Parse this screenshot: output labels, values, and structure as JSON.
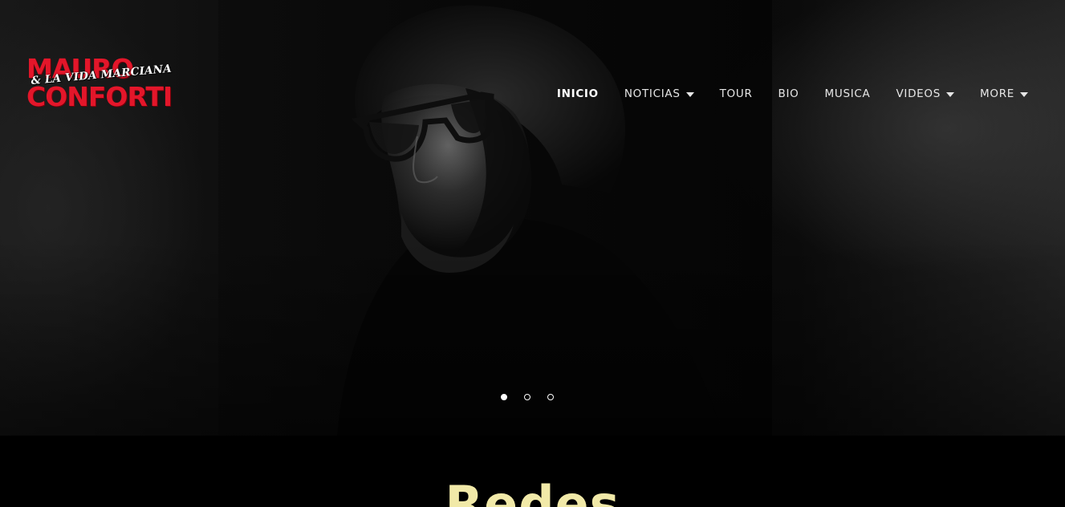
{
  "logo": {
    "line1": "MAURO",
    "subtitle": "& LA VIDA MARCIANA",
    "line2": "CONFORTI",
    "color": "#e3162a"
  },
  "nav": {
    "items": [
      {
        "label": "INICIO",
        "active": true,
        "dropdown": false
      },
      {
        "label": "NOTICIAS",
        "active": false,
        "dropdown": true
      },
      {
        "label": "TOUR",
        "active": false,
        "dropdown": false
      },
      {
        "label": "BIO",
        "active": false,
        "dropdown": false
      },
      {
        "label": "MUSICA",
        "active": false,
        "dropdown": false
      },
      {
        "label": "VIDEOS",
        "active": false,
        "dropdown": true
      },
      {
        "label": "MORE",
        "active": false,
        "dropdown": true
      }
    ]
  },
  "hero": {
    "slides_total": 3,
    "active_slide": 1,
    "image": "black-and-white portrait of a man with glasses"
  },
  "section": {
    "title": "Redes",
    "title_color": "#f1e9a8"
  }
}
